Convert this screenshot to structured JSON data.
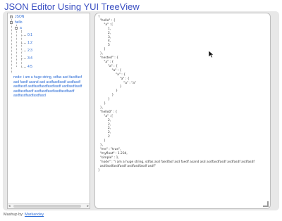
{
  "page": {
    "title": "JSON Editor Using YUI TreeView"
  },
  "tree": {
    "root": "JSON",
    "hello": "hello",
    "a": "a",
    "items": [
      "0:1",
      "1:2",
      "2:3",
      "3:4",
      "4:5"
    ],
    "long_node": "node: i am a huge string, sdfas asd faedfasf asd faedf asand asd asdfasdfasdf asdfasdf asdfasdf asdfasdfasdfasdfasdf asdfasdfasdf asdfasdfasdf asdfasdfasdfasdfasdfasdf asdfasdfasdfasdfasd"
  },
  "editor": {
    "json_text": "{\n  \"hello\" : {\n      \"a\" : [\n          1,\n          2,\n          3,\n          4,\n          5\n      ]\n  },\n  \"nested\" : {\n      \"a\" : {\n          \"a\" : {\n              \"a\" : {\n                  \"a\" : {\n                      \"a\" : {\n                          \"a\" : \"a\"\n                      }\n                  }\n              }\n          }\n      }\n  },\n  \"hello0\" : {\n      \"a\" : [\n          2,\n          2,\n          2,\n          2,\n          2\n      ]\n  },\n  \"me\" : \"true\",\n  \"myfloat\" : 1.234,\n  \"simple\" : 1,\n  \"node\" : \"i am a huge string, sdfas asd faedfasf asd faedf asand asd asdfasdfasdf asdfasdf asdfasdf\n  asdfasdfasdfasdf asdfasdfasdf asdf\"\n}"
  },
  "footer": {
    "prefix": "Mashup by:",
    "author": "Markandey"
  },
  "colors": {
    "title": "#3a4fc2",
    "link": "#2a6bd6",
    "panel_bg": "#e8e8e8"
  }
}
